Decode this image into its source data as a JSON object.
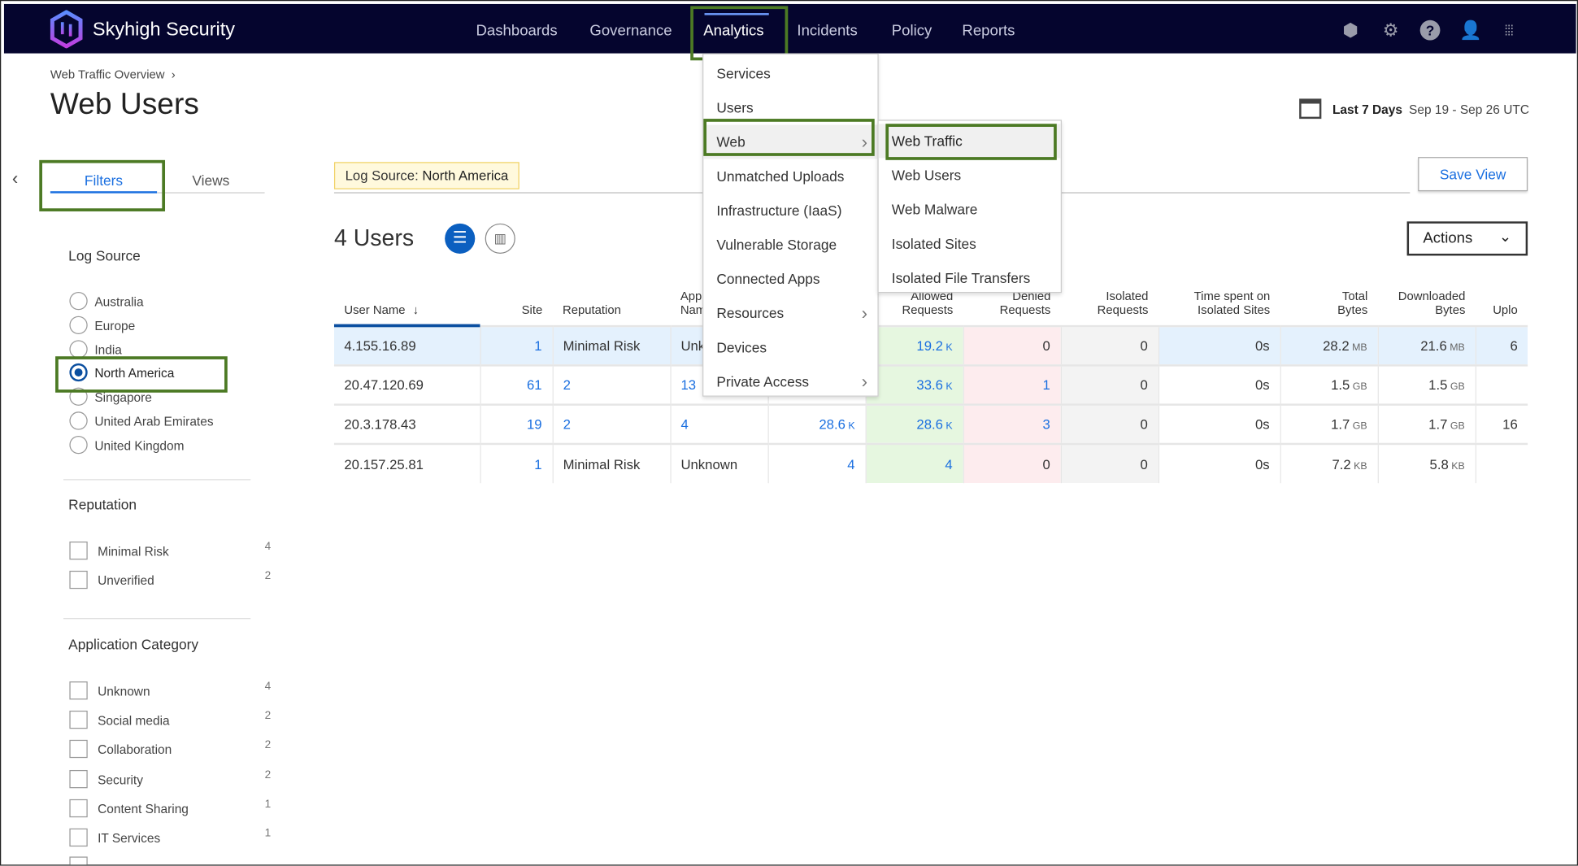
{
  "header": {
    "brand": "Skyhigh Security",
    "nav": [
      "Dashboards",
      "Governance",
      "Analytics",
      "Incidents",
      "Policy",
      "Reports"
    ],
    "active_nav": "Analytics",
    "icons": [
      "shield-icon",
      "gear-icon",
      "help-icon",
      "user-icon",
      "apps-grid-icon"
    ]
  },
  "breadcrumb": "Web Traffic Overview",
  "page_title": "Web Users",
  "date_range": {
    "label": "Last 7 Days",
    "range": "Sep 19 - Sep 26 UTC"
  },
  "panel": {
    "tabs": [
      "Filters",
      "Views"
    ],
    "active_tab": "Filters",
    "log_source": {
      "title": "Log Source",
      "options": [
        "Australia",
        "Europe",
        "India",
        "North America",
        "Singapore",
        "United Arab Emirates",
        "United Kingdom"
      ],
      "selected": "North America"
    },
    "reputation": {
      "title": "Reputation",
      "items": [
        {
          "label": "Minimal Risk",
          "count": "4"
        },
        {
          "label": "Unverified",
          "count": "2"
        }
      ]
    },
    "app_category": {
      "title": "Application Category",
      "items": [
        {
          "label": "Unknown",
          "count": "4"
        },
        {
          "label": "Social media",
          "count": "2"
        },
        {
          "label": "Collaboration",
          "count": "2"
        },
        {
          "label": "Security",
          "count": "2"
        },
        {
          "label": "Content Sharing",
          "count": "1"
        },
        {
          "label": "IT Services",
          "count": "1"
        }
      ]
    }
  },
  "chip": {
    "key": "Log Source:",
    "value": "North America"
  },
  "save_view": "Save View",
  "count_label": "4 Users",
  "actions": "Actions",
  "table": {
    "headers": [
      "User Name",
      "Site",
      "Reputation",
      "App\nName",
      "",
      "Allowed\nRequests",
      "Denied\nRequests",
      "Isolated\nRequests",
      "Time spent on\nIsolated Sites",
      "Total\nBytes",
      "Downloaded\nBytes",
      "Uplo"
    ],
    "rows": [
      [
        "4.155.16.89",
        "1",
        "Minimal Risk",
        "Unknown",
        "",
        "19.2|K",
        "0",
        "0",
        "0s",
        "28.2|MB",
        "21.6|MB",
        "6"
      ],
      [
        "20.47.120.69",
        "61",
        "2",
        "13",
        "",
        "33.6|K",
        "1",
        "0",
        "0s",
        "1.5|GB",
        "1.5|GB",
        ""
      ],
      [
        "20.3.178.43",
        "19",
        "2",
        "4",
        "28.6|K",
        "28.6|K",
        "3",
        "0",
        "0s",
        "1.7|GB",
        "1.7|GB",
        "16"
      ],
      [
        "20.157.25.81",
        "1",
        "Minimal Risk",
        "Unknown",
        "4",
        "4",
        "0",
        "0",
        "0s",
        "7.2|KB",
        "5.8|KB",
        ""
      ]
    ]
  },
  "menu": {
    "items": [
      "Services",
      "Users",
      "Web",
      "Unmatched Uploads",
      "Infrastructure (IaaS)",
      "Vulnerable Storage",
      "Connected Apps",
      "Resources",
      "Devices",
      "Private Access"
    ],
    "active": "Web",
    "submenu": [
      "Web Traffic",
      "Web Users",
      "Web Malware",
      "Isolated Sites",
      "Isolated File Transfers"
    ],
    "sub_active": "Web Traffic"
  },
  "colors": {
    "header_bg": "#05052e",
    "accent": "#1a6fe0",
    "highlight_box": "#4c7a24"
  }
}
